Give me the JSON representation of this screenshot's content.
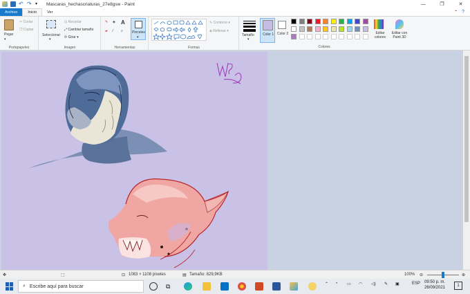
{
  "window": {
    "title": "Mascaras_hechascriaturas_27e8gsw - Paint",
    "minimize": "—",
    "maximize": "❐",
    "close": "✕"
  },
  "tabs": [
    {
      "label": "Archivo"
    },
    {
      "label": "Inicio"
    },
    {
      "label": "Ver"
    }
  ],
  "ribbon": {
    "clipboard": {
      "paste": "Pegar",
      "cut": "Cortar",
      "copy": "Copiar",
      "group": "Portapapeles"
    },
    "image": {
      "select": "Seleccionar",
      "crop": "Recortar",
      "resize": "Cambiar tamaño",
      "rotate": "Girar",
      "group": "Imagen"
    },
    "tools": {
      "brushes": "Pinceles",
      "group": "Herramientas"
    },
    "shapes": {
      "outline": "Contorno",
      "fill": "Rellenar",
      "group": "Formas"
    },
    "size": {
      "label": "Tamaño"
    },
    "colors": {
      "color1": "Color 1",
      "color2": "Color 2",
      "edit": "Editar colores",
      "group": "Colores",
      "color1_value": "#c6bde6",
      "color2_value": "#ffffff",
      "palette": [
        "#000000",
        "#7f7f7f",
        "#880015",
        "#ed1c24",
        "#ff7f27",
        "#fff200",
        "#22b14c",
        "#00a2e8",
        "#3f48cc",
        "#a349a4",
        "#ffffff",
        "#c3c3c3",
        "#b97a57",
        "#ffaec9",
        "#ffc90e",
        "#efe4b0",
        "#b5e61d",
        "#99d9ea",
        "#7092be",
        "#c8bfe7",
        "#a97ac4",
        "#ffffff",
        "#ffffff",
        "#ffffff",
        "#ffffff",
        "#ffffff",
        "#ffffff",
        "#ffffff",
        "#ffffff",
        "#ffffff"
      ]
    },
    "paint3d": {
      "label": "Editar con Paint 3D"
    }
  },
  "status": {
    "dimensions": "1083 × 1108 píxeles",
    "size": "Tamaño: 829,9KB",
    "zoom": "100%"
  },
  "taskbar": {
    "search_placeholder": "Escribe aquí para buscar",
    "lang": "ESP",
    "time": "09:50 p. m.",
    "date": "26/09/2021",
    "notifications": "1"
  }
}
